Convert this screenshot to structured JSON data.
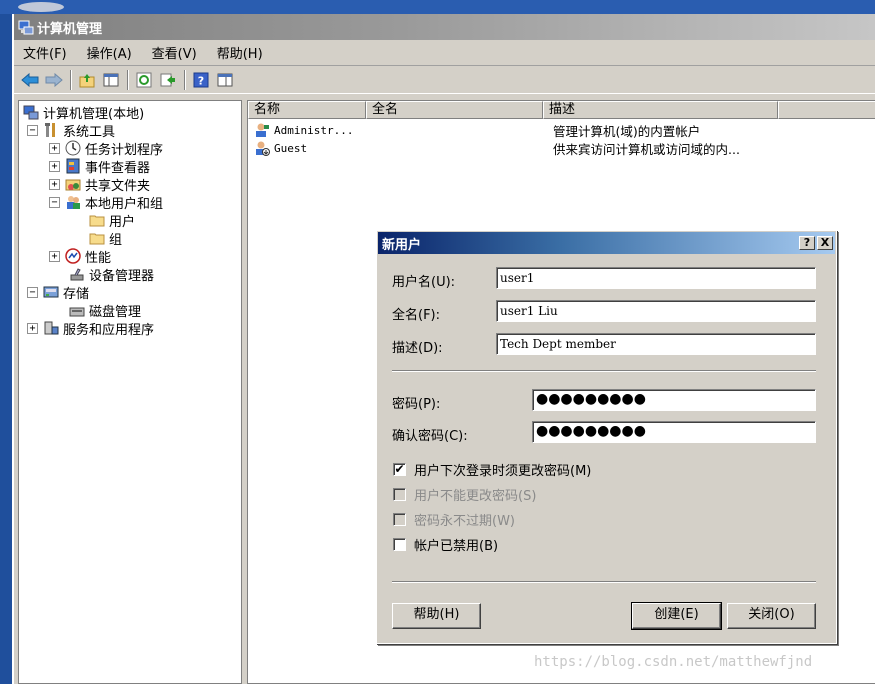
{
  "window": {
    "title": "计算机管理"
  },
  "menu": [
    "文件(F)",
    "操作(A)",
    "查看(V)",
    "帮助(H)"
  ],
  "toolbar": [
    "back-icon",
    "forward-icon",
    "up-folder-icon",
    "show-tree-icon",
    "refresh-icon",
    "export-icon",
    "help-icon",
    "properties-icon"
  ],
  "tree": {
    "root": "计算机管理(本地)",
    "system_tools": "系统工具",
    "task_scheduler": "任务计划程序",
    "event_viewer": "事件查看器",
    "shared_folders": "共享文件夹",
    "local_users": "本地用户和组",
    "users": "用户",
    "groups": "组",
    "performance": "性能",
    "device_manager": "设备管理器",
    "storage": "存储",
    "disk_management": "磁盘管理",
    "services_apps": "服务和应用程序"
  },
  "list": {
    "columns": [
      "名称",
      "全名",
      "描述"
    ],
    "rows": [
      {
        "name": "Administr...",
        "full": "",
        "desc": "管理计算机(域)的内置帐户"
      },
      {
        "name": "Guest",
        "full": "",
        "desc": "供来宾访问计算机或访问域的内..."
      }
    ]
  },
  "dialog": {
    "title": "新用户",
    "help_cap": "?",
    "close_cap": "X",
    "username_label": "用户名(U):",
    "username_value": "user1",
    "fullname_label": "全名(F):",
    "fullname_value": "user1 Liu",
    "desc_label": "描述(D):",
    "desc_value": "Tech Dept member",
    "password_label": "密码(P):",
    "password_value": "●●●●●●●●●",
    "confirm_label": "确认密码(C):",
    "confirm_value": "●●●●●●●●●",
    "checks": [
      {
        "label": "用户下次登录时须更改密码(M)",
        "checked": true,
        "enabled": true
      },
      {
        "label": "用户不能更改密码(S)",
        "checked": false,
        "enabled": false
      },
      {
        "label": "密码永不过期(W)",
        "checked": false,
        "enabled": false
      },
      {
        "label": "帐户已禁用(B)",
        "checked": false,
        "enabled": true
      }
    ],
    "check_mark": "✔",
    "help_button": "帮助(H)",
    "create_button": "创建(E)",
    "close_button": "关闭(O)"
  },
  "watermark": "https://blog.csdn.net/matthewfjnd"
}
